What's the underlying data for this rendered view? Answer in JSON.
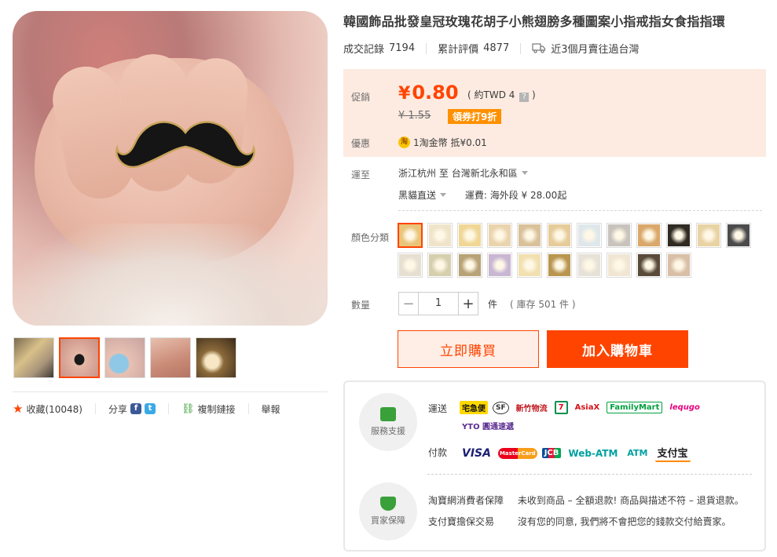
{
  "product": {
    "title": "韓國飾品批發皇冠玫瑰花胡子小熊翅膀多種圖案小指戒指女食指指環"
  },
  "stats": {
    "sales_label": "成交記錄",
    "sales_value": "7194",
    "reviews_label": "累計評價",
    "reviews_value": "4877",
    "shipped_text": "近3個月賣往過台灣"
  },
  "price": {
    "label": "促銷",
    "currency": "¥",
    "amount": "0.80",
    "twd_prefix": "( 約TWD 4",
    "twd_help": "?",
    "twd_suffix": ")",
    "original": "¥ 1.55",
    "coupon": "領券打9折",
    "perk_label": "優惠",
    "perk_coin": "淘",
    "perk_text": "1淘金幣 抵¥0.01"
  },
  "shipping": {
    "label": "運至",
    "from": "浙江杭州",
    "to_word": "至",
    "to": "台灣新北永和區",
    "method": "黑貓直送",
    "fee_text": "運費: 海外段 ¥ 28.00起"
  },
  "variants": {
    "label": "顏色分類",
    "swatch_colors": [
      "#e9c57a",
      "#efe4c9",
      "#f0d796",
      "#ead4ad",
      "#d9c19a",
      "#e6cc9a",
      "#dfe7ea",
      "#c8c3bc",
      "#d9a86a",
      "#2f2a22",
      "#e8d3a4",
      "#4b4b4b",
      "#e6dfd2",
      "#d6cfae",
      "#b8a277",
      "#c9b6d3",
      "#f1e0b0",
      "#b99650",
      "#e7e2d8",
      "#f0e6d3",
      "#5a4a3a",
      "#d8bfa6"
    ]
  },
  "quantity": {
    "label": "數量",
    "value": "1",
    "minus": "−",
    "plus": "+",
    "unit": "件",
    "stock": "( 庫存 501 件 )"
  },
  "buttons": {
    "buy_now": "立即購買",
    "add_cart": "加入購物車"
  },
  "left": {
    "favorite": "收藏(10048)",
    "share": "分享",
    "fb": "f",
    "tw": "t",
    "copy_link": "複制鏈接",
    "report": "舉報"
  },
  "service": {
    "support_label": "服務支援",
    "guarantee_label": "買家保障",
    "delivery_label": "運送",
    "payment_label": "付款",
    "carriers": [
      "宅急便",
      "SF",
      "新竹物流",
      "7",
      "AsiaX",
      "FamilyMart",
      "lequgo",
      "YTO 圓通速遞"
    ],
    "payments": [
      "VISA",
      "MasterCard",
      "JCB",
      "Web-ATM",
      "ATM",
      "支付宝"
    ],
    "rows": [
      {
        "name": "淘寶網消費者保障",
        "desc": "未收到商品 – 全額退款!  商品與描述不符 – 退貨退款。"
      },
      {
        "name": "支付寶擔保交易",
        "desc": "沒有您的同意, 我們將不會把您的錢款交付給賣家。"
      }
    ]
  }
}
